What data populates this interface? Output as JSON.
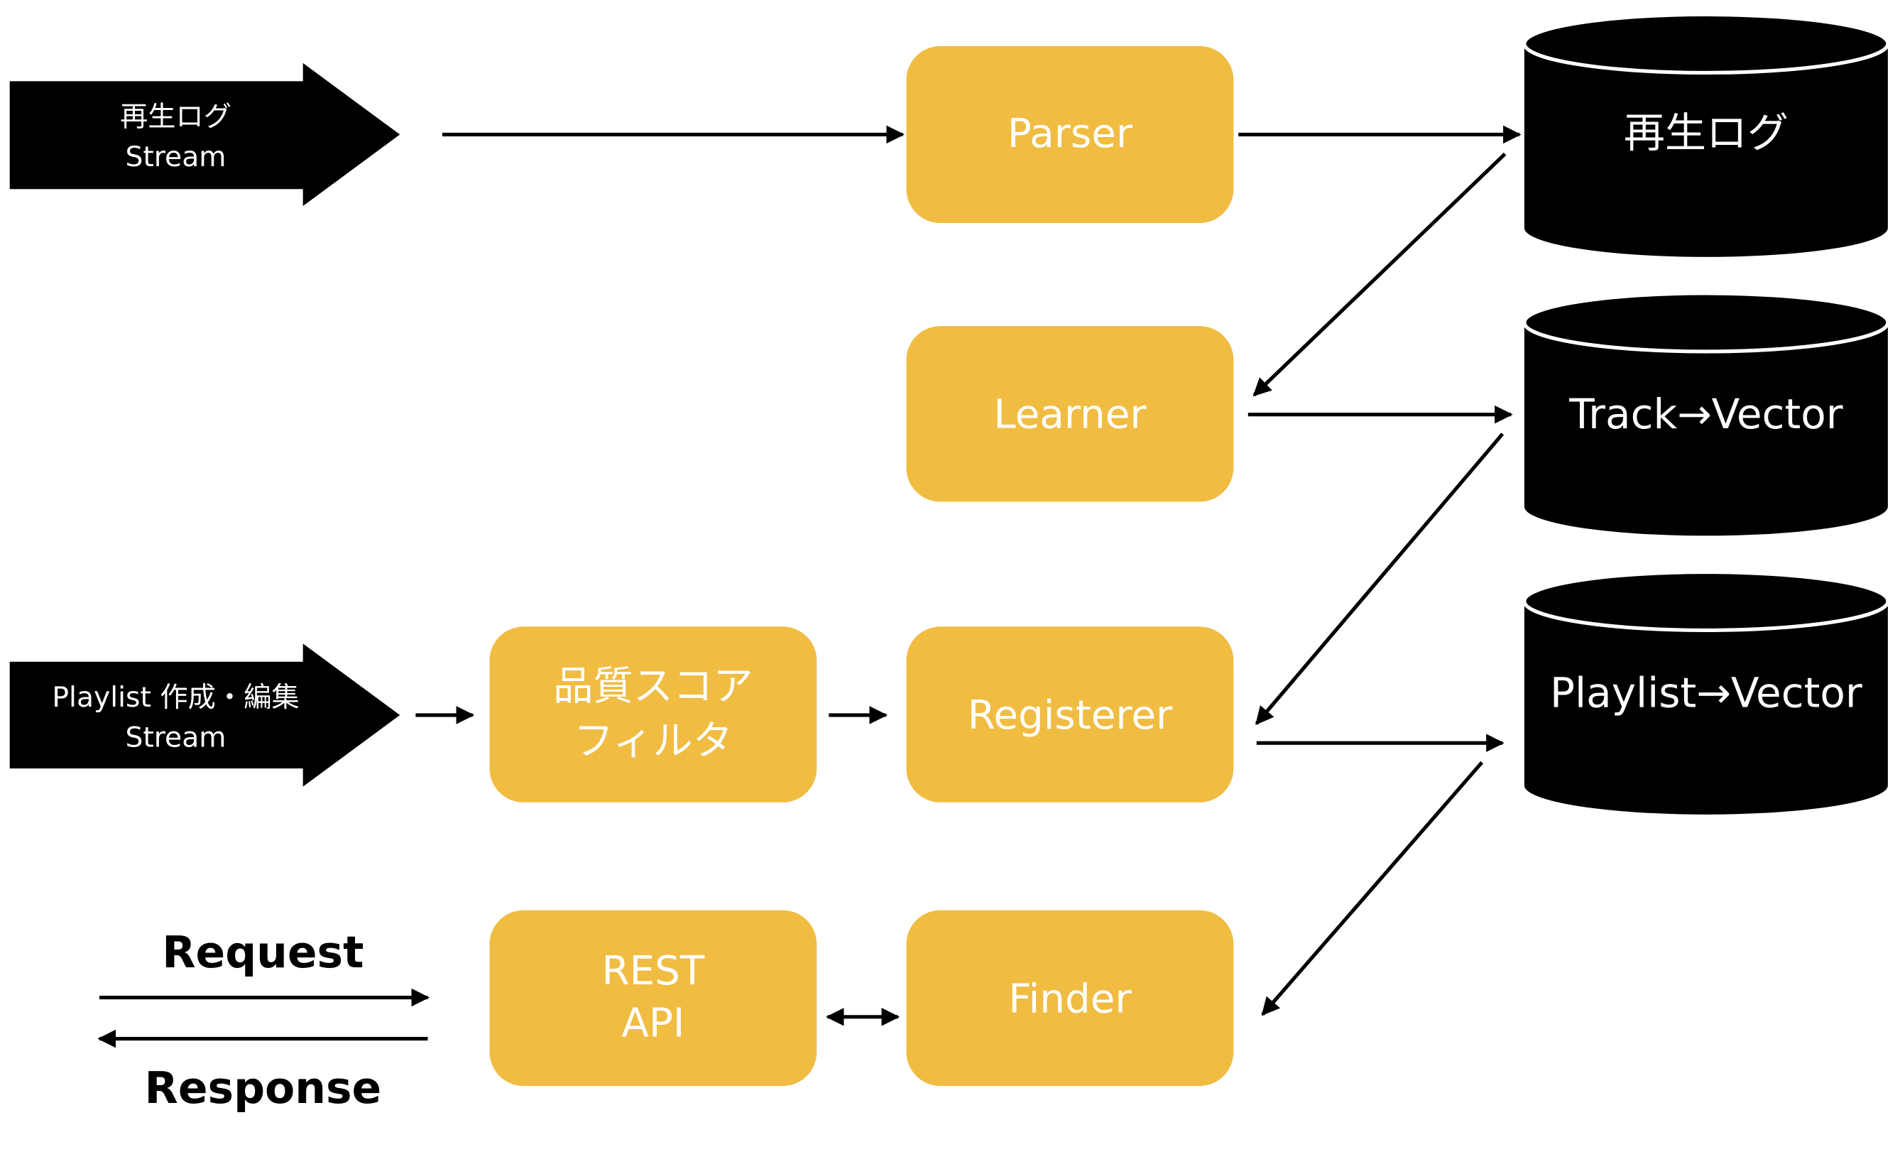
{
  "colors": {
    "process": "#F0BC42",
    "store": "#000000",
    "source": "#000000",
    "text_on_dark": "#ffffff"
  },
  "sources": [
    {
      "line1": "再生ログ",
      "line2": "Stream"
    },
    {
      "line1": "Playlist 作成・編集",
      "line2": "Stream"
    }
  ],
  "processes": {
    "parser": "Parser",
    "learner": "Learner",
    "filter_line1": "品質スコア",
    "filter_line2": "フィルタ",
    "registerer": "Registerer",
    "rest_line1": "REST",
    "rest_line2": "API",
    "finder": "Finder"
  },
  "stores": [
    "再生ログ",
    "Track→Vector",
    "Playlist→Vector"
  ],
  "labels": {
    "request": "Request",
    "response": "Response"
  }
}
